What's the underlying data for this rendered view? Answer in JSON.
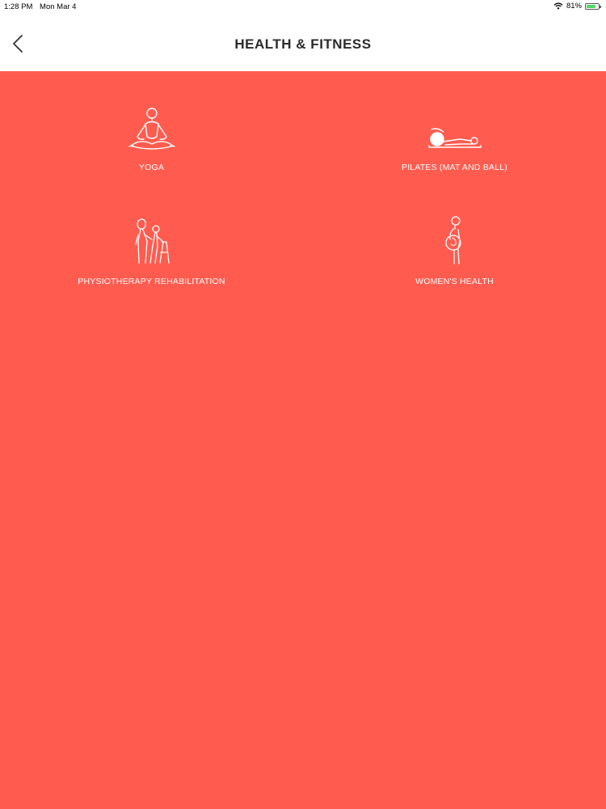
{
  "status_bar": {
    "time": "1:28 PM",
    "date": "Mon Mar 4",
    "battery": "81%",
    "battery_level": 0.81
  },
  "nav": {
    "title": "HEALTH & FITNESS",
    "back_icon": "chevron-left-icon"
  },
  "categories": [
    {
      "label": "YOGA",
      "icon": "yoga-meditation-icon"
    },
    {
      "label": "PILATES (MAT AND BALL)",
      "icon": "pilates-ball-icon"
    },
    {
      "label": "PHYSIOTHERAPY REHABILITATION",
      "icon": "physiotherapy-icon"
    },
    {
      "label": "WOMEN'S HEALTH",
      "icon": "pregnant-woman-icon"
    }
  ],
  "colors": {
    "background": "#ff5c4f",
    "nav_background": "#ffffff",
    "title_text": "#2b2b2b",
    "label_text": "#ffffff"
  }
}
